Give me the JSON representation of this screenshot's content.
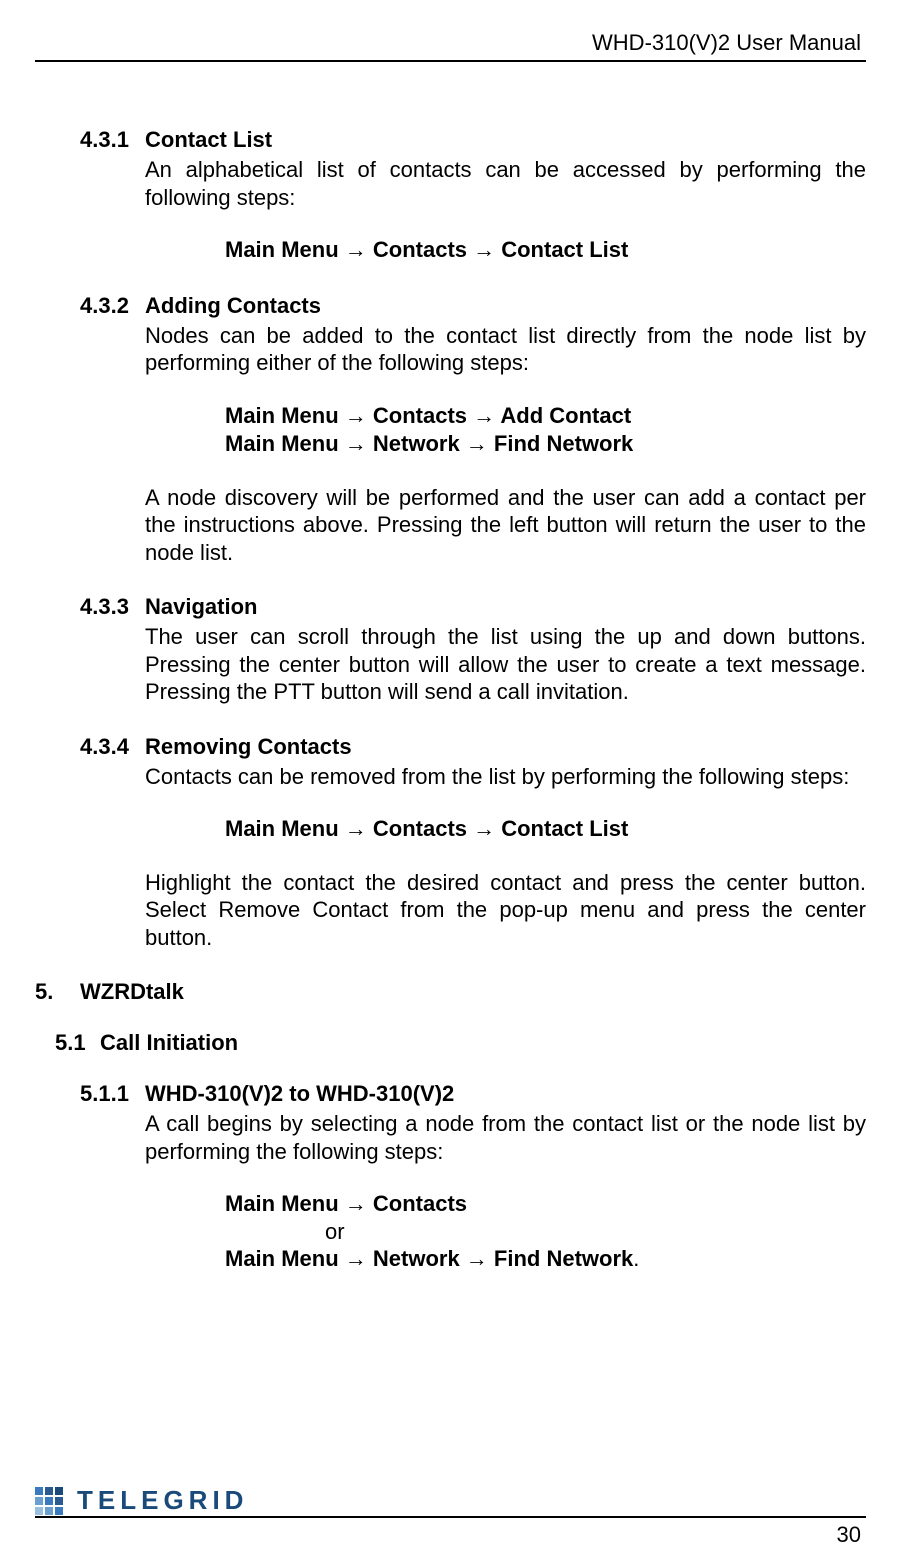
{
  "header": {
    "title": "WHD-310(V)2 User Manual"
  },
  "s431": {
    "num": "4.3.1",
    "title": "Contact List",
    "body": "An alphabetical list of contacts can be accessed by performing the following steps:",
    "nav": "Main Menu → Contacts → Contact List"
  },
  "s432": {
    "num": "4.3.2",
    "title": "Adding Contacts",
    "body1": "Nodes can be added to the contact list directly from the node list by performing either of the following steps:",
    "nav1": "Main Menu → Contacts → Add Contact",
    "nav2": "Main Menu → Network → Find Network",
    "body2": "A node discovery will be performed and the user can add a contact per the instructions above.  Pressing the left button will return the user to the node list."
  },
  "s433": {
    "num": "4.3.3",
    "title": "Navigation",
    "body": "The user can scroll through the list using the up and down buttons.  Pressing the center button will allow the user to create a text message.  Pressing the PTT button will send a call invitation."
  },
  "s434": {
    "num": "4.3.4",
    "title": "Removing Contacts",
    "body1": "Contacts can be removed from the list by performing the following steps:",
    "nav": "Main Menu → Contacts → Contact List",
    "body2": "Highlight the contact the desired contact and press the center button.  Select Remove Contact from the pop-up menu and press the center button."
  },
  "s5": {
    "num": "5.",
    "title": "WZRDtalk"
  },
  "s51": {
    "num": "5.1",
    "title": "Call Initiation"
  },
  "s511": {
    "num": "5.1.1",
    "title": "WHD-310(V)2 to WHD-310(V)2",
    "body": "A call begins by selecting a node from the contact list or the node list by performing the following steps:",
    "nav1": "Main Menu → Contacts",
    "or": "or",
    "nav2": "Main Menu → Network → Find Network",
    "nav2suffix": "."
  },
  "logo": {
    "text": "TELEGRID"
  },
  "page": {
    "num": "30"
  }
}
